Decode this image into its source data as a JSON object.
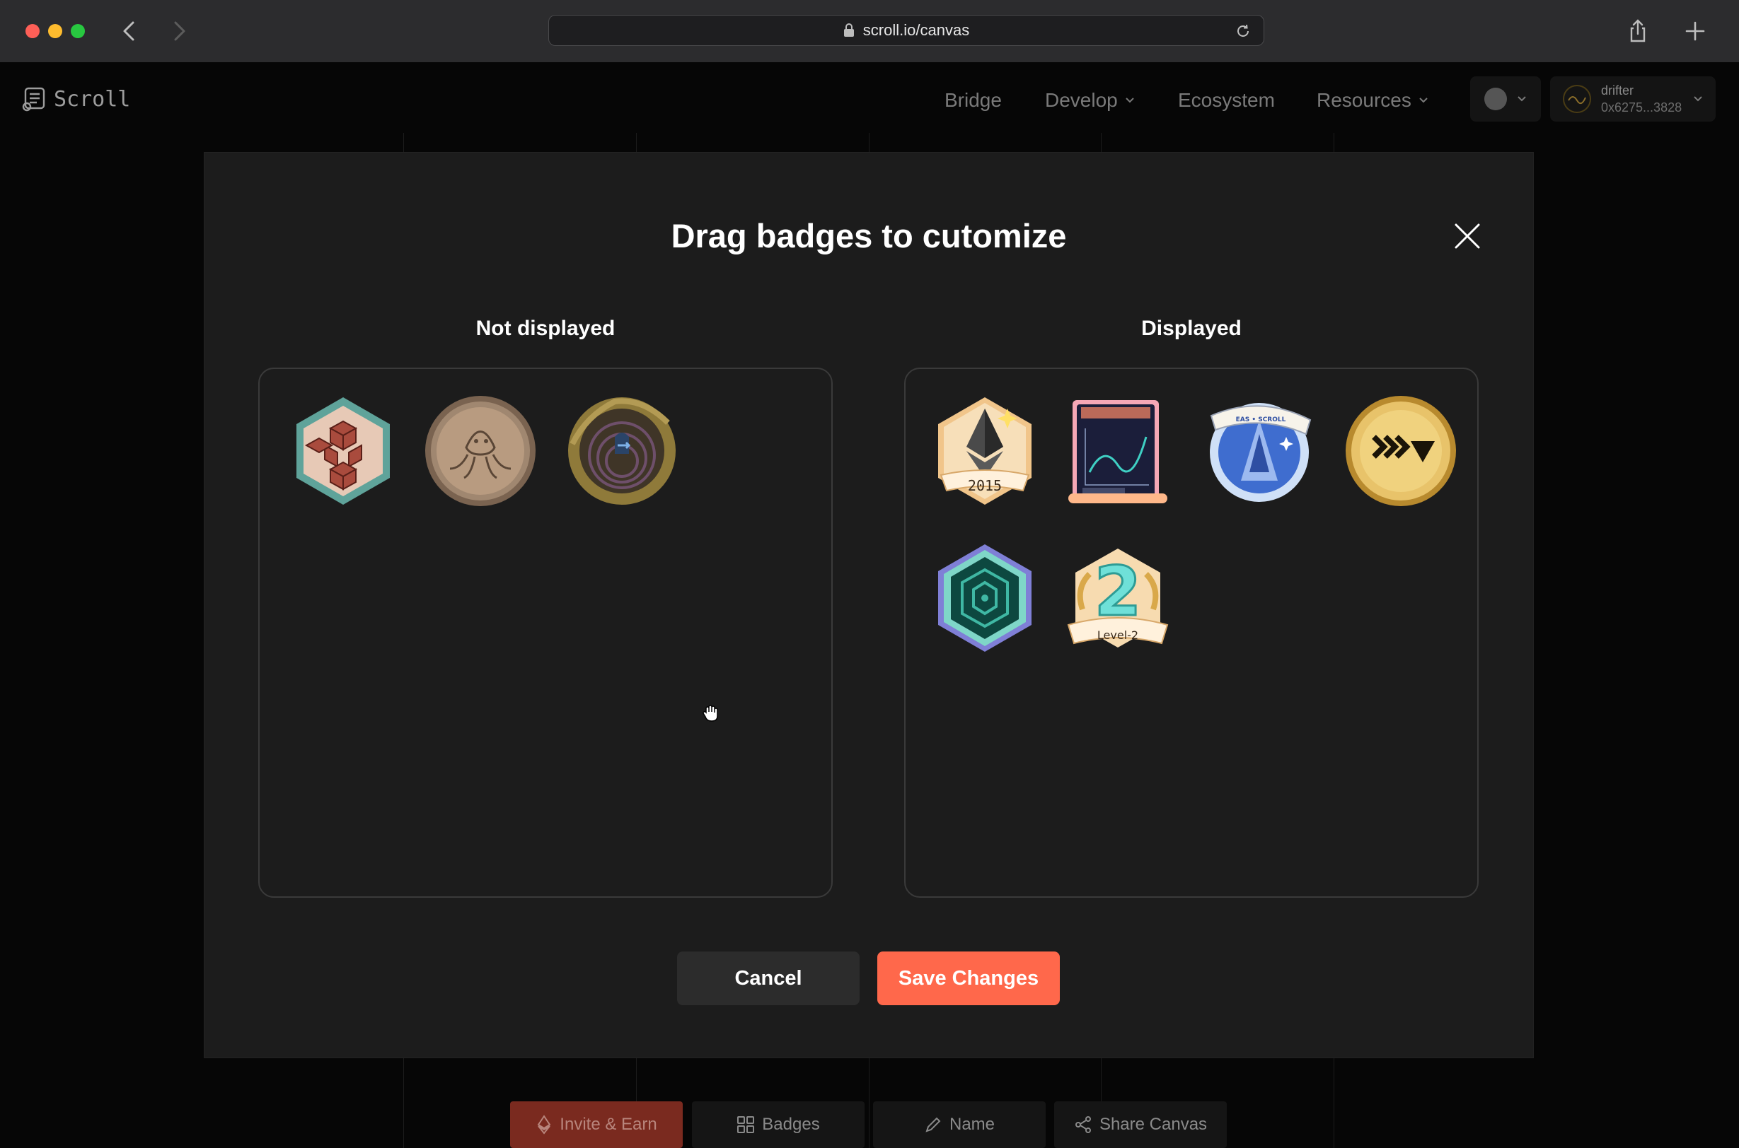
{
  "browser": {
    "url": "scroll.io/canvas"
  },
  "site": {
    "brand": "Scroll",
    "nav": [
      {
        "label": "Bridge",
        "has_dropdown": false
      },
      {
        "label": "Develop",
        "has_dropdown": true
      },
      {
        "label": "Ecosystem",
        "has_dropdown": false
      },
      {
        "label": "Resources",
        "has_dropdown": true
      }
    ],
    "wallet": {
      "name": "drifter",
      "address": "0x6275...3828"
    }
  },
  "bottom_toolbar": {
    "invite": "Invite & Earn",
    "badges": "Badges",
    "name": "Name",
    "share": "Share Canvas"
  },
  "modal": {
    "title": "Drag badges to cutomize",
    "not_displayed_title": "Not displayed",
    "displayed_title": "Displayed",
    "not_displayed_badges": [
      "hexagon-cubes-badge",
      "octopus-coin-badge",
      "mossy-portal-badge"
    ],
    "displayed_badges": [
      "ethereum-2015-badge",
      "chart-scroll-card-badge",
      "eas-scroll-badge",
      "gold-chevron-coin-badge",
      "hexagon-maze-badge",
      "level-2-badge"
    ],
    "badge_2015_text": "2015",
    "badge_level_text": "Level-2",
    "badge_eas_text": "EAS • SCROLL",
    "cancel_label": "Cancel",
    "save_label": "Save Changes"
  },
  "colors": {
    "accent": "#ff684b",
    "modal_bg": "#1c1c1c"
  }
}
